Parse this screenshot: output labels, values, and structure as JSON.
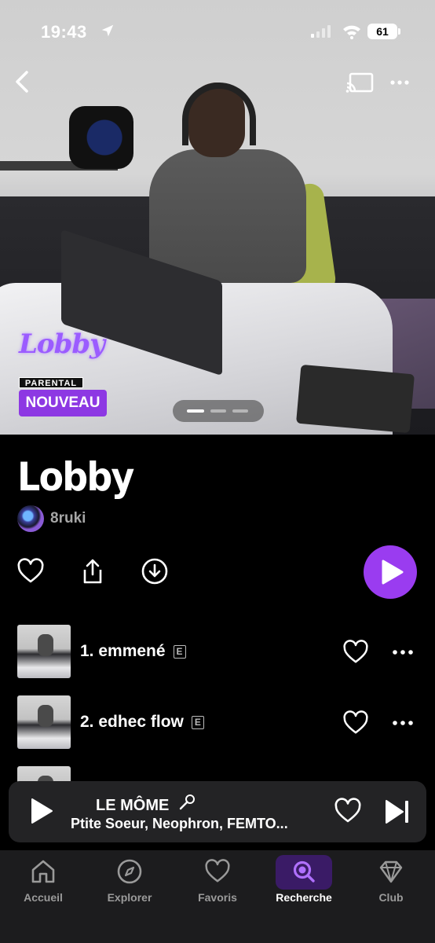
{
  "status_bar": {
    "time": "19:43",
    "battery": "61"
  },
  "cover": {
    "logo_text": "Lobby",
    "parental_label": "PARENTAL",
    "badge": "NOUVEAU",
    "pager": {
      "count": 3,
      "active": 0
    }
  },
  "album": {
    "title": "Lobby",
    "artist": "8ruki"
  },
  "actions": {
    "like_icon": "heart-icon",
    "share_icon": "share-icon",
    "download_icon": "download-icon",
    "play_icon": "play-icon",
    "accent_color": "#9a3cf0"
  },
  "tracks": [
    {
      "title": "1. emmené",
      "explicit": "E"
    },
    {
      "title": "2. edhec flow",
      "explicit": "E"
    }
  ],
  "now_playing": {
    "title": "LE MÔME",
    "artists": "Ptite Soeur, Neophron, FEMTO..."
  },
  "tabbar": {
    "items": [
      {
        "label": "Accueil",
        "icon": "home-icon"
      },
      {
        "label": "Explorer",
        "icon": "compass-icon"
      },
      {
        "label": "Favoris",
        "icon": "heart-icon"
      },
      {
        "label": "Recherche",
        "icon": "search-icon"
      },
      {
        "label": "Club",
        "icon": "diamond-icon"
      }
    ],
    "active_index": 3
  }
}
